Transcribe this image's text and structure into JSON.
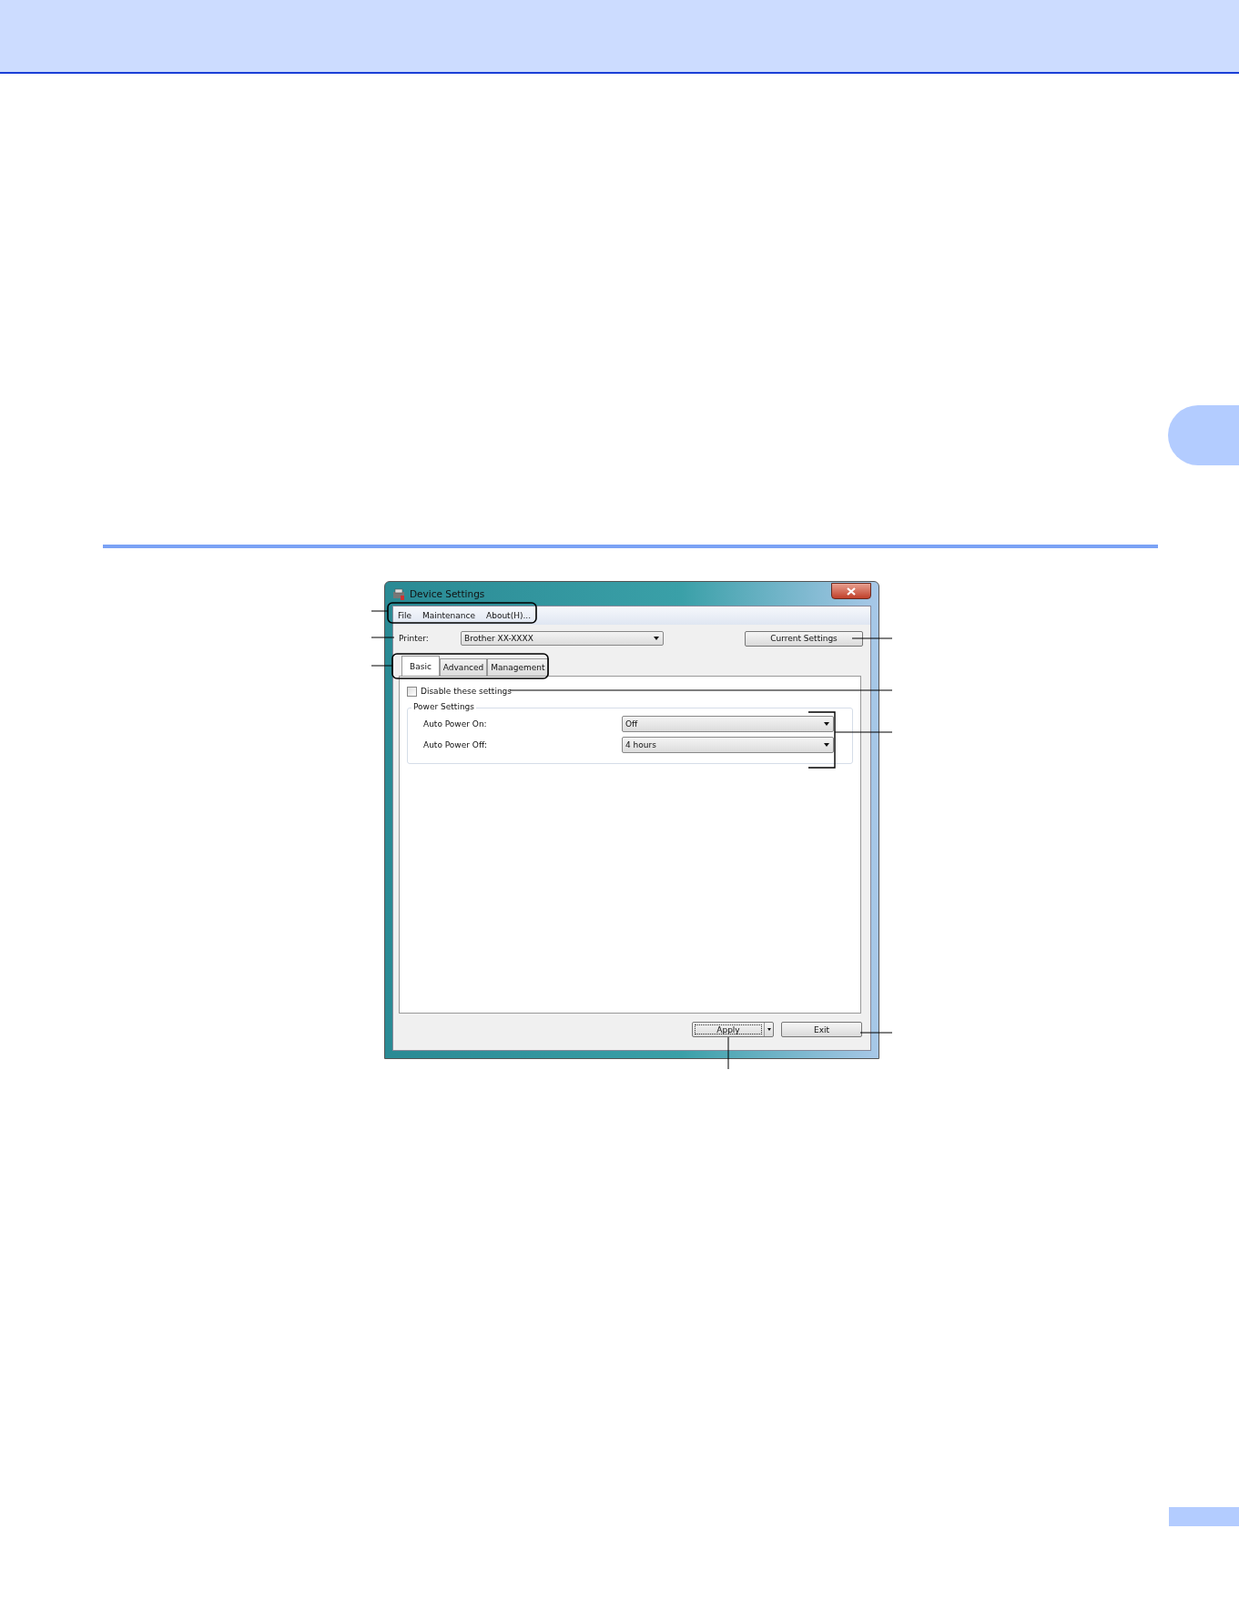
{
  "window": {
    "title": "Device Settings"
  },
  "menu": [
    {
      "label": "File"
    },
    {
      "label": "Maintenance"
    },
    {
      "label": "About(H)..."
    }
  ],
  "printer": {
    "label": "Printer:",
    "value": "Brother XX-XXXX"
  },
  "current_settings_button": "Current Settings",
  "tabs": [
    {
      "label": "Basic",
      "selected": true
    },
    {
      "label": "Advanced",
      "selected": false
    },
    {
      "label": "Management",
      "selected": false
    }
  ],
  "disable_checkbox": {
    "label": "Disable these settings",
    "checked": false
  },
  "power_settings": {
    "title": "Power Settings",
    "fields": [
      {
        "label": "Auto Power On:",
        "value": "Off"
      },
      {
        "label": "Auto Power Off:",
        "value": "4 hours"
      }
    ]
  },
  "buttons": [
    {
      "label": "Apply",
      "kind": "split"
    },
    {
      "label": "Exit",
      "kind": "plain"
    }
  ]
}
